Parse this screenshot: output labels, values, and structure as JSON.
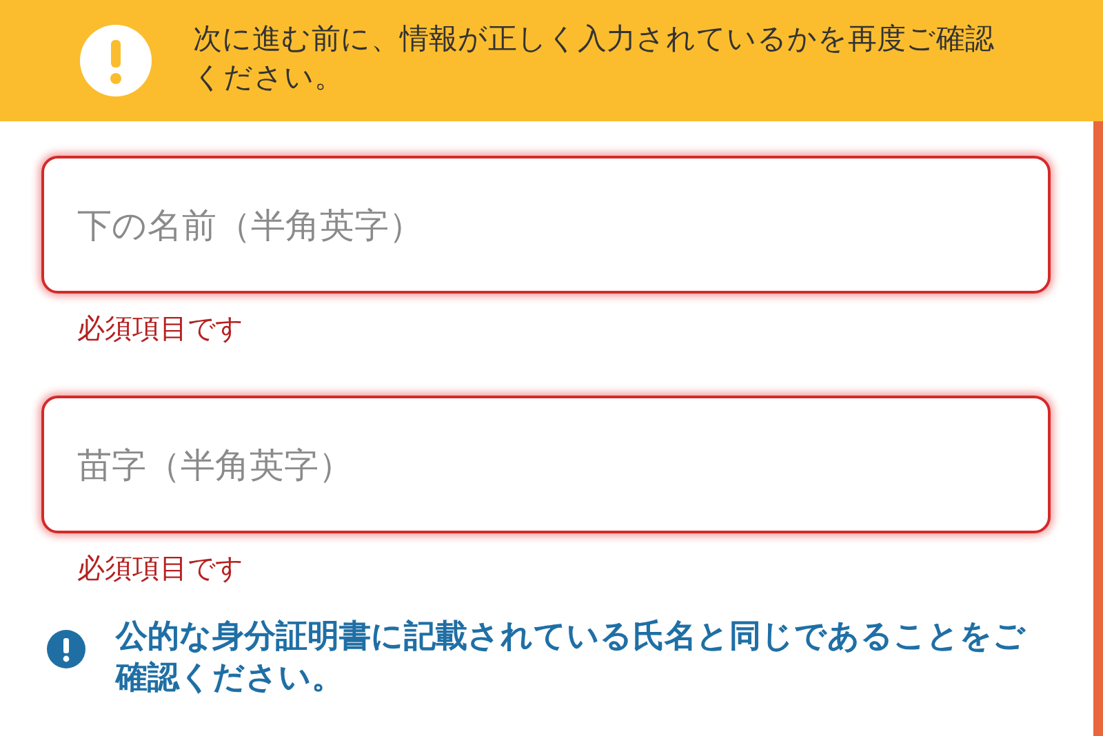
{
  "banner": {
    "message": "次に進む前に、情報が正しく入力されているかを再度ご確認ください。"
  },
  "fields": [
    {
      "placeholder": "下の名前（半角英字）",
      "error": "必須項目です",
      "invalid": true
    },
    {
      "placeholder": "苗字（半角英字）",
      "error": "必須項目です",
      "invalid": true
    }
  ],
  "notice": {
    "text": "公的な身分証明書に記載されている氏名と同じであることをご確認ください。"
  }
}
